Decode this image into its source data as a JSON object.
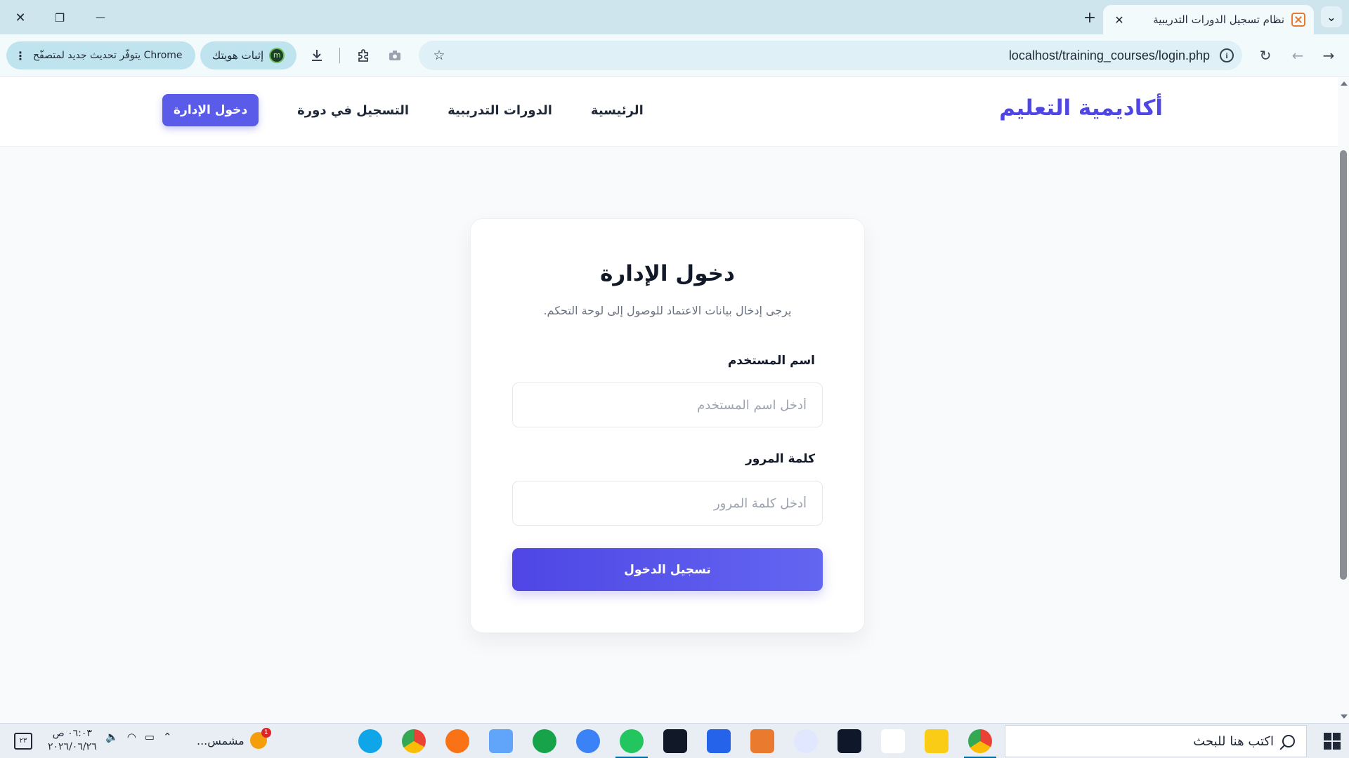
{
  "browser": {
    "tab_title": "نظام تسجيل الدورات التدريبية",
    "tab_close": "✕",
    "new_tab": "+",
    "url": "localhost/training_courses/login.php",
    "profile_label": "إثبات هويتك",
    "profile_avatar": "m",
    "update_label": "يتوفّر تحديث جديد لمتصفّح Chrome",
    "update_menu": "⋮",
    "bookmark_star": "☆",
    "info_icon": "i",
    "window_close": "✕",
    "window_restore": "❐",
    "window_minimize": "—",
    "back": "←",
    "forward": "→",
    "reload": "↻",
    "tabs_menu": "⌄"
  },
  "site": {
    "logo": "أكاديمية التعليم",
    "nav": [
      {
        "label": "الرئيسية"
      },
      {
        "label": "الدورات التدريبية"
      },
      {
        "label": "التسجيل في دورة"
      },
      {
        "label": "دخول الإدارة"
      }
    ]
  },
  "login": {
    "title": "دخول الإدارة",
    "subtitle": "يرجى إدخال بيانات الاعتماد للوصول إلى لوحة التحكم.",
    "username_label": "اسم المستخدم",
    "username_placeholder": "أدخل اسم المستخدم",
    "password_label": "كلمة المرور",
    "password_placeholder": "أدخل كلمة المرور",
    "submit_label": "تسجيل الدخول"
  },
  "taskbar": {
    "search_placeholder": "اكتب هنا للبحث",
    "weather_label": "مشمس...",
    "weather_badge": "1",
    "time": "٠٦:٠٣ ص",
    "date": "٢٠٢٦/٠٦/٢٦",
    "notifications_badge": "٢٣"
  },
  "colors": {
    "accent": "#4f46e5",
    "tabstrip": "#cfe5ed",
    "page_bg": "#f8fafc"
  }
}
